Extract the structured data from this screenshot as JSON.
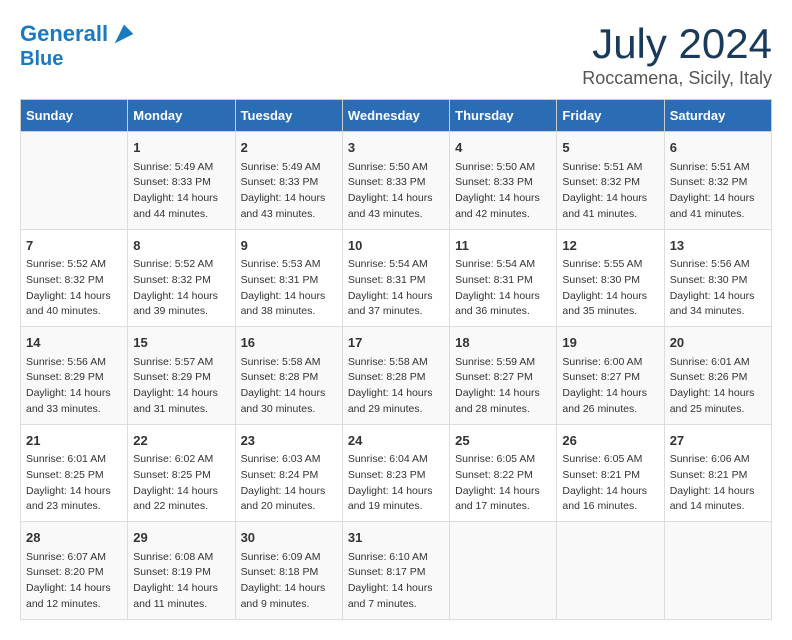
{
  "header": {
    "logo_line1": "General",
    "logo_line2": "Blue",
    "month": "July 2024",
    "location": "Roccamena, Sicily, Italy"
  },
  "weekdays": [
    "Sunday",
    "Monday",
    "Tuesday",
    "Wednesday",
    "Thursday",
    "Friday",
    "Saturday"
  ],
  "weeks": [
    [
      {
        "day": "",
        "info": ""
      },
      {
        "day": "1",
        "info": "Sunrise: 5:49 AM\nSunset: 8:33 PM\nDaylight: 14 hours\nand 44 minutes."
      },
      {
        "day": "2",
        "info": "Sunrise: 5:49 AM\nSunset: 8:33 PM\nDaylight: 14 hours\nand 43 minutes."
      },
      {
        "day": "3",
        "info": "Sunrise: 5:50 AM\nSunset: 8:33 PM\nDaylight: 14 hours\nand 43 minutes."
      },
      {
        "day": "4",
        "info": "Sunrise: 5:50 AM\nSunset: 8:33 PM\nDaylight: 14 hours\nand 42 minutes."
      },
      {
        "day": "5",
        "info": "Sunrise: 5:51 AM\nSunset: 8:32 PM\nDaylight: 14 hours\nand 41 minutes."
      },
      {
        "day": "6",
        "info": "Sunrise: 5:51 AM\nSunset: 8:32 PM\nDaylight: 14 hours\nand 41 minutes."
      }
    ],
    [
      {
        "day": "7",
        "info": "Sunrise: 5:52 AM\nSunset: 8:32 PM\nDaylight: 14 hours\nand 40 minutes."
      },
      {
        "day": "8",
        "info": "Sunrise: 5:52 AM\nSunset: 8:32 PM\nDaylight: 14 hours\nand 39 minutes."
      },
      {
        "day": "9",
        "info": "Sunrise: 5:53 AM\nSunset: 8:31 PM\nDaylight: 14 hours\nand 38 minutes."
      },
      {
        "day": "10",
        "info": "Sunrise: 5:54 AM\nSunset: 8:31 PM\nDaylight: 14 hours\nand 37 minutes."
      },
      {
        "day": "11",
        "info": "Sunrise: 5:54 AM\nSunset: 8:31 PM\nDaylight: 14 hours\nand 36 minutes."
      },
      {
        "day": "12",
        "info": "Sunrise: 5:55 AM\nSunset: 8:30 PM\nDaylight: 14 hours\nand 35 minutes."
      },
      {
        "day": "13",
        "info": "Sunrise: 5:56 AM\nSunset: 8:30 PM\nDaylight: 14 hours\nand 34 minutes."
      }
    ],
    [
      {
        "day": "14",
        "info": "Sunrise: 5:56 AM\nSunset: 8:29 PM\nDaylight: 14 hours\nand 33 minutes."
      },
      {
        "day": "15",
        "info": "Sunrise: 5:57 AM\nSunset: 8:29 PM\nDaylight: 14 hours\nand 31 minutes."
      },
      {
        "day": "16",
        "info": "Sunrise: 5:58 AM\nSunset: 8:28 PM\nDaylight: 14 hours\nand 30 minutes."
      },
      {
        "day": "17",
        "info": "Sunrise: 5:58 AM\nSunset: 8:28 PM\nDaylight: 14 hours\nand 29 minutes."
      },
      {
        "day": "18",
        "info": "Sunrise: 5:59 AM\nSunset: 8:27 PM\nDaylight: 14 hours\nand 28 minutes."
      },
      {
        "day": "19",
        "info": "Sunrise: 6:00 AM\nSunset: 8:27 PM\nDaylight: 14 hours\nand 26 minutes."
      },
      {
        "day": "20",
        "info": "Sunrise: 6:01 AM\nSunset: 8:26 PM\nDaylight: 14 hours\nand 25 minutes."
      }
    ],
    [
      {
        "day": "21",
        "info": "Sunrise: 6:01 AM\nSunset: 8:25 PM\nDaylight: 14 hours\nand 23 minutes."
      },
      {
        "day": "22",
        "info": "Sunrise: 6:02 AM\nSunset: 8:25 PM\nDaylight: 14 hours\nand 22 minutes."
      },
      {
        "day": "23",
        "info": "Sunrise: 6:03 AM\nSunset: 8:24 PM\nDaylight: 14 hours\nand 20 minutes."
      },
      {
        "day": "24",
        "info": "Sunrise: 6:04 AM\nSunset: 8:23 PM\nDaylight: 14 hours\nand 19 minutes."
      },
      {
        "day": "25",
        "info": "Sunrise: 6:05 AM\nSunset: 8:22 PM\nDaylight: 14 hours\nand 17 minutes."
      },
      {
        "day": "26",
        "info": "Sunrise: 6:05 AM\nSunset: 8:21 PM\nDaylight: 14 hours\nand 16 minutes."
      },
      {
        "day": "27",
        "info": "Sunrise: 6:06 AM\nSunset: 8:21 PM\nDaylight: 14 hours\nand 14 minutes."
      }
    ],
    [
      {
        "day": "28",
        "info": "Sunrise: 6:07 AM\nSunset: 8:20 PM\nDaylight: 14 hours\nand 12 minutes."
      },
      {
        "day": "29",
        "info": "Sunrise: 6:08 AM\nSunset: 8:19 PM\nDaylight: 14 hours\nand 11 minutes."
      },
      {
        "day": "30",
        "info": "Sunrise: 6:09 AM\nSunset: 8:18 PM\nDaylight: 14 hours\nand 9 minutes."
      },
      {
        "day": "31",
        "info": "Sunrise: 6:10 AM\nSunset: 8:17 PM\nDaylight: 14 hours\nand 7 minutes."
      },
      {
        "day": "",
        "info": ""
      },
      {
        "day": "",
        "info": ""
      },
      {
        "day": "",
        "info": ""
      }
    ]
  ]
}
